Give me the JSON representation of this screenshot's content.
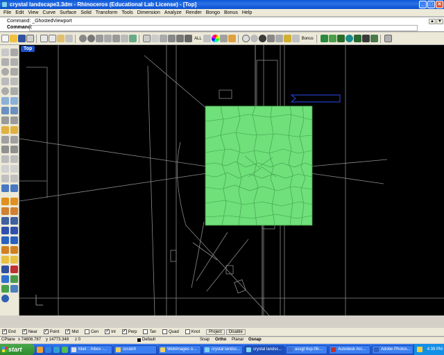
{
  "window": {
    "title": "crystal landscape3.3dm - Rhinoceros (Educational Lab License) - [Top]",
    "controls": [
      "_",
      "□",
      "✕"
    ]
  },
  "menu": [
    "File",
    "Edit",
    "View",
    "Curve",
    "Surface",
    "Solid",
    "Transform",
    "Tools",
    "Dimension",
    "Analyze",
    "Render",
    "Bongo",
    "Bonus",
    "Help"
  ],
  "command": {
    "history_label": "Command:",
    "history_value": "_GhostedViewport",
    "prompt_label": "Command:",
    "input_value": ""
  },
  "toolbar": {
    "all_label": "ALL",
    "bonus_label": "Bonus"
  },
  "viewport": {
    "name": "Top",
    "background": "#000000",
    "surface_color": "#6fe07a"
  },
  "osnap": {
    "items": [
      {
        "label": "End",
        "checked": true
      },
      {
        "label": "Near",
        "checked": true
      },
      {
        "label": "Point",
        "checked": true
      },
      {
        "label": "Mid",
        "checked": true
      },
      {
        "label": "Cen",
        "checked": false
      },
      {
        "label": "Int",
        "checked": true
      },
      {
        "label": "Perp",
        "checked": true
      },
      {
        "label": "Tan",
        "checked": false
      },
      {
        "label": "Quad",
        "checked": false
      },
      {
        "label": "Knot",
        "checked": false
      }
    ],
    "project_label": "Project",
    "disable_label": "Disable"
  },
  "status": {
    "cplane": "CPlane",
    "x": "x 74808.787",
    "y": "y 14773.348",
    "z": "z 0",
    "layer": "Default",
    "snap": "Snap",
    "ortho": "Ortho",
    "planar": "Planar",
    "osnap": "Osnap"
  },
  "taskbar": {
    "start": "start",
    "tasks": [
      {
        "label": "Mail :: Inbox -...",
        "color": "#e0e0e0",
        "active": false
      },
      {
        "label": "scratch",
        "color": "#f0d060",
        "active": false
      },
      {
        "label": "WebImages o...",
        "color": "#f0d060",
        "active": false
      },
      {
        "label": "crystal landsc...",
        "color": "#7fd3f0",
        "active": false
      },
      {
        "label": "crystal landsc...",
        "color": "#7fd3f0",
        "active": true
      },
      {
        "label": "assgt 6sp.06-...",
        "color": "#4070d0",
        "active": false
      },
      {
        "label": "Autodesk Arc...",
        "color": "#c03030",
        "active": false
      },
      {
        "label": "Adobe Photos...",
        "color": "#3060c0",
        "active": false
      }
    ],
    "clock": "4:39 PM"
  }
}
